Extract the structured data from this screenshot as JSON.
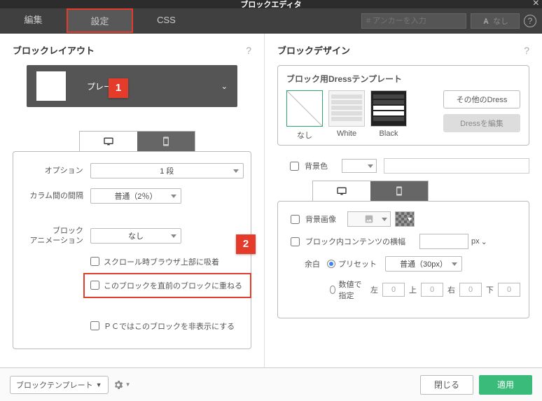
{
  "header": {
    "title": "ブロックエディタ"
  },
  "tabs": {
    "edit": "編集",
    "settings": "設定",
    "css": "CSS"
  },
  "topright": {
    "anchor_placeholder": "# アンカーを入力",
    "font_label": "なし"
  },
  "badges": {
    "one": "1",
    "two": "2"
  },
  "left": {
    "title": "ブロックレイアウト",
    "layout_name": "プレーン",
    "option_label": "オプション",
    "option_value": "1 段",
    "gap_label": "カラム間の間隔",
    "gap_value": "普通（2％）",
    "anim_label1": "ブロック",
    "anim_label2": "アニメーション",
    "anim_value": "なし",
    "cb_scroll": "スクロール時ブラウザ上部に吸着",
    "cb_overlap": "このブロックを直前のブロックに重ねる",
    "cb_hidepc": "ＰＣではこのブロックを非表示にする"
  },
  "right": {
    "title": "ブロックデザイン",
    "dress_title": "ブロック用Dressテンプレート",
    "tmpl_none": "なし",
    "tmpl_white": "White",
    "tmpl_black": "Black",
    "btn_other": "その他のDress",
    "btn_edit": "Dressを編集",
    "cb_bgcolor": "背景色",
    "cb_bgimg": "背景画像",
    "cb_contentw": "ブロック内コンテンツの横幅",
    "px_label": "px",
    "margin_label": "余白",
    "preset_label": "プリセット",
    "preset_value": "普通（30px）",
    "numeric_label": "数値で指定",
    "m_left": "左",
    "m_top": "上",
    "m_right": "右",
    "m_bottom": "下",
    "zero": "0"
  },
  "footer": {
    "template_dd": "ブロックテンプレート",
    "close": "閉じる",
    "apply": "適用"
  }
}
